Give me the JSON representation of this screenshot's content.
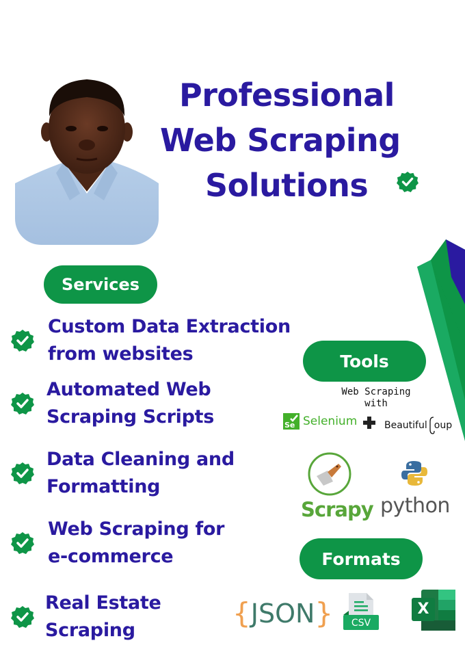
{
  "title": {
    "line1": "Professional",
    "line2": "Web Scraping",
    "line3": "Solutions"
  },
  "colors": {
    "primary_blue": "#2a1aa0",
    "brand_green": "#0e9547",
    "light_green": "#1aaa62"
  },
  "services": {
    "label": "Services",
    "items": [
      {
        "line1": "Custom Data Extraction",
        "line2": "from websites"
      },
      {
        "line1": "Automated Web",
        "line2": "Scraping Scripts"
      },
      {
        "line1": "Data Cleaning and",
        "line2": "Formatting"
      },
      {
        "line1": "Web  Scraping  for",
        "line2": "e-commerce"
      },
      {
        "line1": "Real Estate",
        "line2": "Scraping"
      }
    ]
  },
  "tools": {
    "label": "Tools",
    "subtitle_line1": "Web Scraping",
    "subtitle_line2": "with",
    "selenium": "Selenium",
    "selenium_badge": "Se",
    "beautifulsoup": "BeautifulSoup",
    "beautifulsoup_display_a": "Beautiful",
    "beautifulsoup_display_b": "oup",
    "scrapy": "Scrapy",
    "python": "python"
  },
  "formats": {
    "label": "Formats",
    "json": "JSON",
    "json_brace_open": "{",
    "json_brace_close": "}",
    "csv": "CSV",
    "excel": "X"
  }
}
